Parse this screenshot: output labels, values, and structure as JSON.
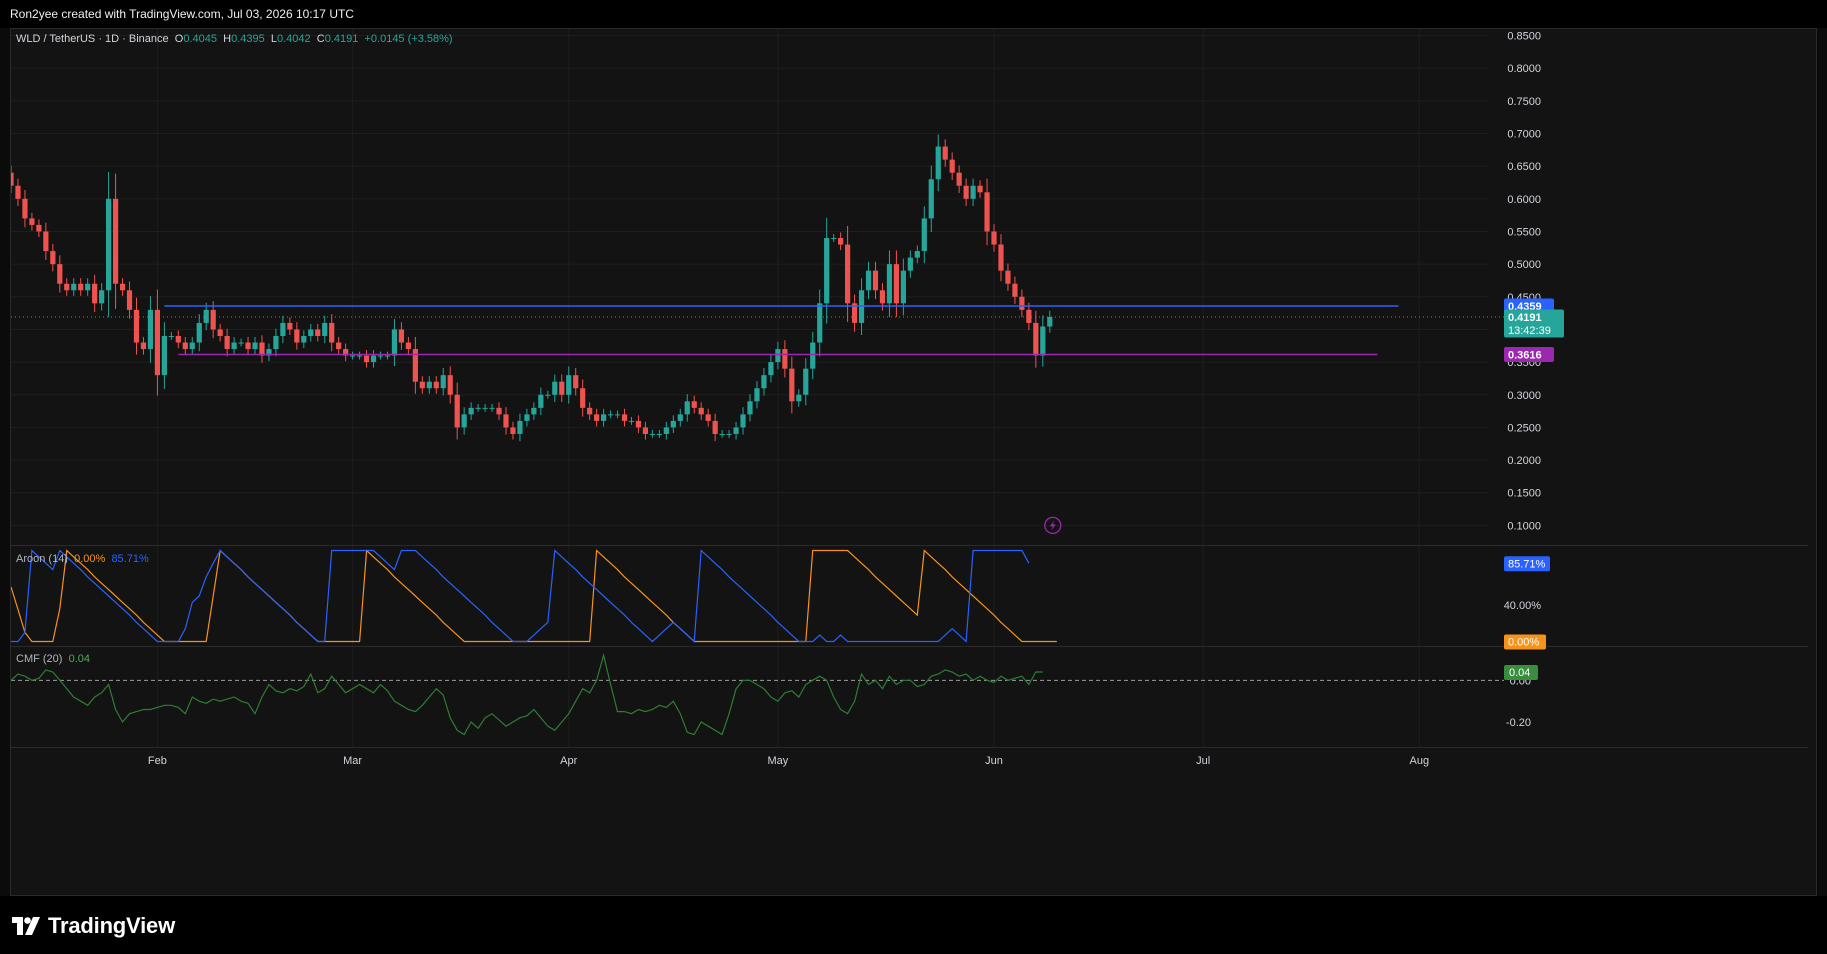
{
  "credit": "Ron2yee created with TradingView.com, Jul 03, 2026 10:17 UTC",
  "brand": "TradingView",
  "legend": {
    "symbol": "WLD / TetherUS · 1D · Binance",
    "o_label": "O",
    "o": "0.4045",
    "h_label": "H",
    "h": "0.4395",
    "l_label": "L",
    "l": "0.4042",
    "c_label": "C",
    "c": "0.4191",
    "change": "+0.0145 (+3.58%)"
  },
  "aroon_legend": {
    "name": "Aroon (14)",
    "up": "0.00%",
    "down": "85.71%"
  },
  "cmf_legend": {
    "name": "CMF (20)",
    "value": "0.04"
  },
  "colors": {
    "up": "#26a69a",
    "down": "#ef5350",
    "resistance": "#2962ff",
    "support": "#9c27b0",
    "aroon_up": "#f7931a",
    "aroon_down": "#2962ff",
    "cmf": "#2e7d32",
    "current": "#26a69a"
  },
  "chart_data": [
    {
      "type": "candlestick",
      "title": "WLD / TetherUS · 1D · Binance",
      "x_range": [
        "2025-01-11",
        "2025-08-11"
      ],
      "ylim": [
        0.07,
        0.86
      ],
      "y_ticks": [
        "0.8500",
        "0.8000",
        "0.7500",
        "0.7000",
        "0.6500",
        "0.6000",
        "0.5500",
        "0.5000",
        "0.4500",
        "0.4000",
        "0.3500",
        "0.3000",
        "0.2500",
        "0.2000",
        "0.1500",
        "0.1000"
      ],
      "x_ticks": [
        {
          "date": "2025-02-01",
          "label": "Feb"
        },
        {
          "date": "2025-03-01",
          "label": "Mar"
        },
        {
          "date": "2025-04-01",
          "label": "Apr"
        },
        {
          "date": "2025-05-01",
          "label": "May"
        },
        {
          "date": "2025-06-01",
          "label": "Jun"
        },
        {
          "date": "2025-07-01",
          "label": "Jul"
        },
        {
          "date": "2025-08-01",
          "label": "Aug"
        }
      ],
      "first_date": "2025-01-11",
      "closes": [
        0.62,
        0.6,
        0.57,
        0.56,
        0.55,
        0.52,
        0.5,
        0.47,
        0.46,
        0.47,
        0.46,
        0.47,
        0.44,
        0.46,
        0.6,
        0.47,
        0.46,
        0.43,
        0.38,
        0.37,
        0.43,
        0.33,
        0.39,
        0.39,
        0.38,
        0.37,
        0.38,
        0.41,
        0.43,
        0.4,
        0.39,
        0.37,
        0.38,
        0.38,
        0.37,
        0.38,
        0.36,
        0.37,
        0.39,
        0.41,
        0.4,
        0.38,
        0.39,
        0.4,
        0.39,
        0.41,
        0.38,
        0.37,
        0.36,
        0.36,
        0.36,
        0.35,
        0.36,
        0.36,
        0.36,
        0.4,
        0.38,
        0.37,
        0.32,
        0.31,
        0.32,
        0.31,
        0.33,
        0.3,
        0.25,
        0.27,
        0.28,
        0.28,
        0.28,
        0.28,
        0.27,
        0.25,
        0.24,
        0.26,
        0.27,
        0.28,
        0.3,
        0.3,
        0.32,
        0.3,
        0.33,
        0.31,
        0.28,
        0.27,
        0.26,
        0.27,
        0.27,
        0.27,
        0.26,
        0.26,
        0.25,
        0.24,
        0.24,
        0.24,
        0.25,
        0.26,
        0.27,
        0.29,
        0.28,
        0.27,
        0.26,
        0.24,
        0.24,
        0.24,
        0.25,
        0.27,
        0.29,
        0.31,
        0.33,
        0.35,
        0.37,
        0.34,
        0.29,
        0.3,
        0.34,
        0.38,
        0.44,
        0.54,
        0.54,
        0.53,
        0.44,
        0.41,
        0.46,
        0.49,
        0.46,
        0.44,
        0.5,
        0.44,
        0.49,
        0.51,
        0.52,
        0.57,
        0.63,
        0.68,
        0.66,
        0.64,
        0.62,
        0.6,
        0.62,
        0.61,
        0.55,
        0.53,
        0.49,
        0.47,
        0.45,
        0.43,
        0.41,
        0.36,
        0.4045,
        0.4191
      ],
      "current_price": "0.4191",
      "countdown": "13:42:39",
      "levels": [
        {
          "name": "resistance",
          "value": 0.4359,
          "label": "0.4359",
          "from": "2025-02-02",
          "to": "2025-07-29"
        },
        {
          "name": "support",
          "value": 0.3616,
          "label": "0.3616",
          "from": "2025-02-04",
          "to": "2025-07-26"
        }
      ]
    },
    {
      "type": "line",
      "title": "Aroon (14)",
      "ylim": [
        -5,
        105
      ],
      "y_ticks": [
        "40.00%"
      ],
      "series": [
        {
          "name": "Aroon Up",
          "values": [
            60,
            35,
            10,
            0,
            0,
            0,
            0,
            36,
            100,
            93,
            86,
            79,
            71,
            64,
            57,
            50,
            43,
            36,
            29,
            21,
            14,
            7,
            0,
            0,
            0,
            0,
            0,
            0,
            0,
            50,
            100,
            93,
            86,
            79,
            71,
            64,
            57,
            50,
            43,
            36,
            29,
            21,
            14,
            7,
            0,
            0,
            0,
            0,
            0,
            0,
            0,
            100,
            93,
            86,
            79,
            71,
            64,
            57,
            50,
            43,
            36,
            29,
            21,
            14,
            7,
            0,
            0,
            0,
            0,
            0,
            0,
            0,
            0,
            0,
            0,
            0,
            0,
            0,
            0,
            0,
            0,
            0,
            0,
            0,
            100,
            93,
            86,
            79,
            71,
            64,
            57,
            50,
            43,
            36,
            29,
            21,
            14,
            7,
            0,
            0,
            0,
            0,
            0,
            0,
            0,
            0,
            0,
            0,
            0,
            0,
            0,
            0,
            0,
            0,
            0,
            100,
            100,
            100,
            100,
            100,
            100,
            93,
            86,
            79,
            71,
            64,
            57,
            50,
            43,
            36,
            29,
            100,
            93,
            86,
            79,
            71,
            64,
            57,
            50,
            43,
            36,
            29,
            21,
            14,
            7,
            0,
            0,
            0,
            0,
            0,
            0
          ]
        },
        {
          "name": "Aroon Down",
          "values": [
            0,
            0,
            0,
            0,
            100,
            100,
            100,
            100,
            100,
            100,
            100,
            100,
            100,
            93,
            86,
            79,
            71,
            64,
            57,
            50,
            43,
            36,
            29,
            21,
            14,
            7,
            0,
            0,
            0,
            0,
            0,
            7,
            14,
            21,
            0,
            0,
            0,
            0,
            0,
            0,
            0,
            0,
            0,
            0,
            0,
            0,
            0,
            0,
            0,
            0,
            0,
            0,
            0,
            0,
            0,
            0,
            0,
            0,
            0,
            0,
            0,
            0,
            0,
            0,
            0,
            0,
            0,
            0,
            0,
            0,
            0,
            0,
            0,
            0,
            0,
            0,
            0,
            0,
            0,
            0,
            0,
            0,
            0,
            0,
            0,
            0,
            0,
            0,
            0,
            0,
            0,
            0,
            0,
            0,
            0,
            0,
            0,
            0,
            0,
            0,
            0,
            0,
            0,
            0,
            0,
            0,
            0,
            0,
            0,
            0,
            0,
            0,
            0,
            0,
            0,
            0,
            0,
            0,
            0,
            0,
            0,
            0,
            0,
            0,
            0,
            0,
            0,
            0,
            0,
            0,
            0,
            0,
            0,
            0,
            0,
            0,
            0,
            0,
            0,
            0,
            0,
            0,
            0,
            0,
            0,
            0,
            0,
            0,
            0,
            0,
            0,
            0
          ]
        },
        {
          "name": "Aroon Down (alt)",
          "values": [
            0,
            0,
            10,
            100,
            93,
            86,
            79,
            100,
            93,
            86,
            79,
            71,
            64,
            57,
            50,
            43,
            36,
            29,
            21,
            14,
            7,
            0,
            0,
            0,
            0,
            14,
            43,
            50,
            71,
            86,
            100,
            93,
            86,
            79,
            71,
            64,
            57,
            50,
            43,
            36,
            29,
            21,
            14,
            7,
            0,
            0,
            100,
            100,
            100,
            100,
            100,
            100,
            100,
            93,
            86,
            79,
            100,
            100,
            100,
            93,
            86,
            79,
            71,
            64,
            57,
            50,
            43,
            36,
            29,
            21,
            14,
            7,
            0,
            0,
            0,
            7,
            14,
            21,
            100,
            93,
            86,
            79,
            71,
            64,
            57,
            50,
            43,
            36,
            29,
            21,
            14,
            7,
            0,
            7,
            14,
            21,
            14,
            7,
            0,
            100,
            93,
            86,
            79,
            71,
            64,
            57,
            50,
            43,
            36,
            29,
            21,
            14,
            7,
            0,
            0,
            0,
            7,
            0,
            0,
            7,
            0,
            0,
            0,
            0,
            0,
            0,
            0,
            0,
            0,
            0,
            0,
            0,
            0,
            0,
            7,
            14,
            7,
            0,
            100,
            100,
            100,
            100,
            100,
            100,
            100,
            100,
            86
          ]
        }
      ],
      "last_up": "0.00%",
      "last_down": "85.71%"
    },
    {
      "type": "line",
      "title": "CMF (20)",
      "ylim": [
        -0.32,
        0.16
      ],
      "y_ticks": [
        "0.00",
        "-0.20"
      ],
      "series": [
        {
          "name": "CMF",
          "values": [
            0.0,
            0.03,
            0.02,
            0.0,
            0.01,
            0.05,
            0.04,
            0.0,
            -0.04,
            -0.08,
            -0.1,
            -0.12,
            -0.08,
            -0.06,
            -0.02,
            -0.14,
            -0.2,
            -0.16,
            -0.15,
            -0.14,
            -0.14,
            -0.13,
            -0.12,
            -0.12,
            -0.13,
            -0.16,
            -0.08,
            -0.1,
            -0.11,
            -0.09,
            -0.1,
            -0.09,
            -0.08,
            -0.1,
            -0.11,
            -0.16,
            -0.08,
            -0.02,
            -0.05,
            -0.06,
            -0.04,
            -0.05,
            -0.03,
            0.03,
            -0.06,
            -0.04,
            0.02,
            -0.02,
            -0.06,
            -0.04,
            -0.02,
            -0.04,
            -0.06,
            -0.02,
            -0.05,
            -0.1,
            -0.12,
            -0.14,
            -0.15,
            -0.12,
            -0.08,
            -0.04,
            -0.07,
            -0.18,
            -0.24,
            -0.26,
            -0.2,
            -0.23,
            -0.18,
            -0.16,
            -0.19,
            -0.22,
            -0.2,
            -0.18,
            -0.17,
            -0.14,
            -0.18,
            -0.22,
            -0.24,
            -0.2,
            -0.16,
            -0.1,
            -0.04,
            -0.06,
            0.0,
            0.12,
            -0.02,
            -0.15,
            -0.15,
            -0.16,
            -0.14,
            -0.15,
            -0.14,
            -0.12,
            -0.13,
            -0.1,
            -0.16,
            -0.25,
            -0.26,
            -0.2,
            -0.22,
            -0.24,
            -0.26,
            -0.16,
            -0.04,
            0.0,
            0.0,
            -0.02,
            -0.04,
            -0.08,
            -0.1,
            -0.06,
            -0.05,
            -0.08,
            -0.02,
            0.0,
            0.02,
            0.0,
            -0.08,
            -0.14,
            -0.16,
            -0.1,
            0.03,
            -0.02,
            0.0,
            -0.04,
            0.02,
            -0.02,
            0.0,
            0.0,
            -0.03,
            -0.02,
            0.02,
            0.03,
            0.05,
            0.04,
            0.02,
            0.03,
            0.0,
            0.02,
            0.0,
            -0.01,
            0.02,
            0.0,
            0.01,
            0.02,
            -0.02,
            0.04,
            0.04
          ]
        }
      ],
      "last": "0.04"
    }
  ]
}
